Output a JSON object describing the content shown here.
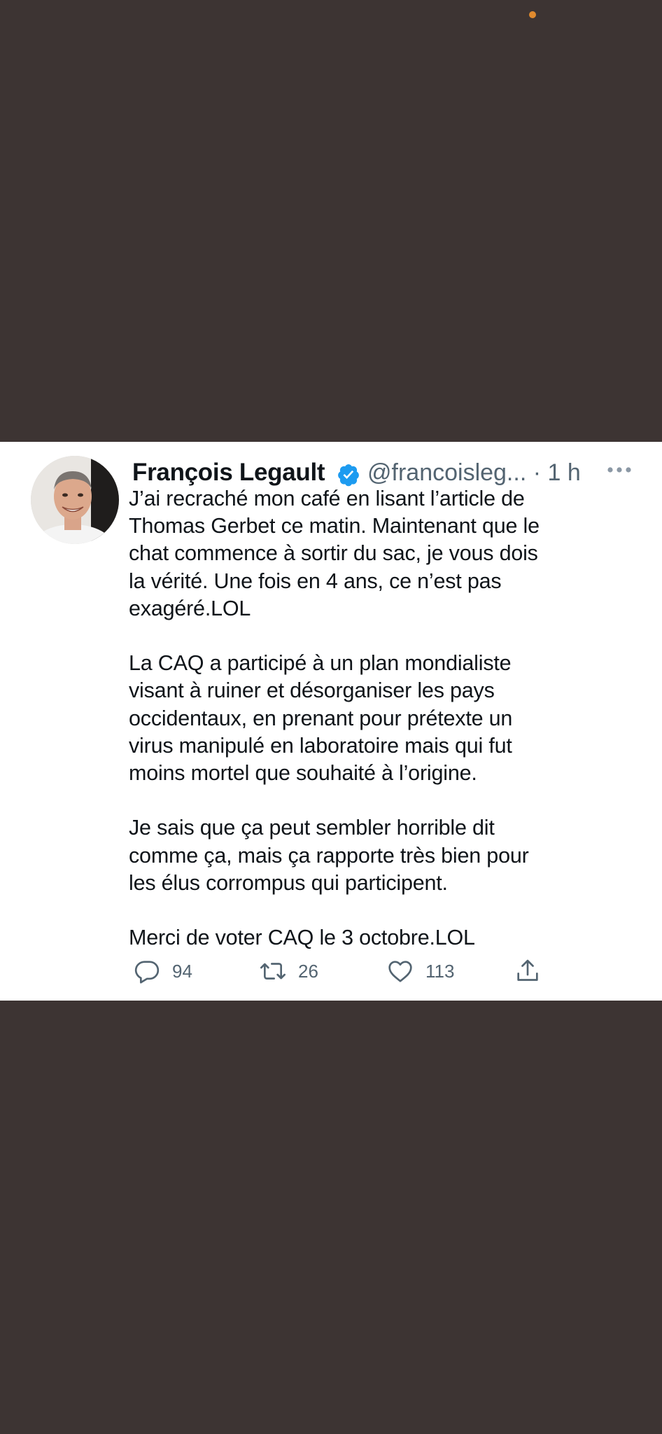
{
  "tweet": {
    "author": {
      "display_name": "François Legault",
      "handle": "@francoisleg...",
      "verified": true
    },
    "time_separator": " · ",
    "time": "1 h",
    "text": "J’ai recraché mon café en lisant l’article de\nThomas Gerbet ce matin. Maintenant que le\nchat commence à sortir du sac, je vous dois\nla vérité. Une fois en 4 ans, ce n’est pas\nexagéré.LOL\n\nLa CAQ a participé à un plan mondialiste\nvisant à ruiner et désorganiser les pays\noccidentaux, en prenant pour prétexte un\nvirus manipulé en laboratoire mais qui fut\nmoins mortel que souhaité à l’origine.\n\nJe sais que ça peut sembler horrible dit\ncomme ça, mais ça rapporte très bien pour\nles élus corrompus qui participent.\n\nMerci de voter CAQ le 3 octobre.LOL",
    "actions": {
      "reply_count": "94",
      "retweet_count": "26",
      "like_count": "113"
    }
  },
  "icons": {
    "verified": "verified-badge-icon",
    "more": "more-horizontal-icon",
    "reply": "reply-icon",
    "retweet": "retweet-icon",
    "like": "heart-icon",
    "share": "share-icon"
  },
  "colors": {
    "background": "#3d3433",
    "card": "#ffffff",
    "text_primary": "#0f1419",
    "text_secondary": "#536471",
    "verified_blue": "#1d9bf0",
    "status_dot": "#e08a2e"
  }
}
